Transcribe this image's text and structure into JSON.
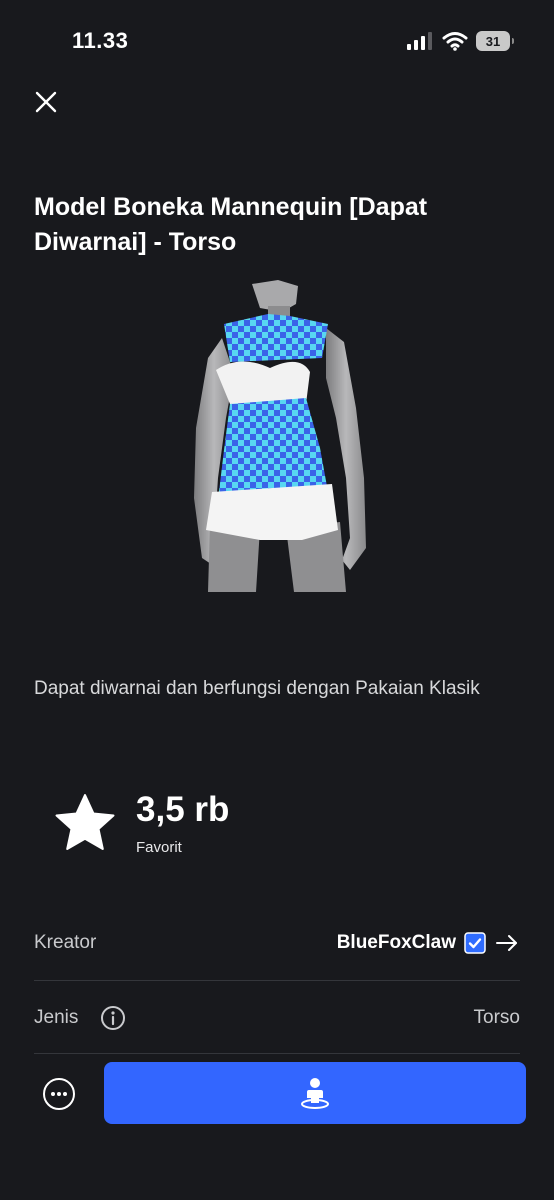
{
  "status_bar": {
    "time": "11.33",
    "battery": "31"
  },
  "item": {
    "title": "Model Boneka Mannequin [Dapat Diwarnai] - Torso",
    "description": "Dapat diwarnai dan berfungsi dengan Pakaian Klasik",
    "favorite_count": "3,5 rb",
    "favorite_label": "Favorit"
  },
  "details": {
    "creator_label": "Kreator",
    "creator_name": "BlueFoxClaw",
    "type_label": "Jenis",
    "type_value": "Torso"
  },
  "icons": {
    "close": "close-icon",
    "star": "star-icon",
    "verified": "verified-badge-icon",
    "arrow": "arrow-right-icon",
    "info": "info-icon",
    "more": "more-icon",
    "try_on": "avatar-try-on-icon"
  },
  "colors": {
    "background": "#18191d",
    "primary_button": "#3366ff",
    "verified": "#2f6cff",
    "checker_a": "#3a63e8",
    "checker_b": "#58d6f2"
  }
}
